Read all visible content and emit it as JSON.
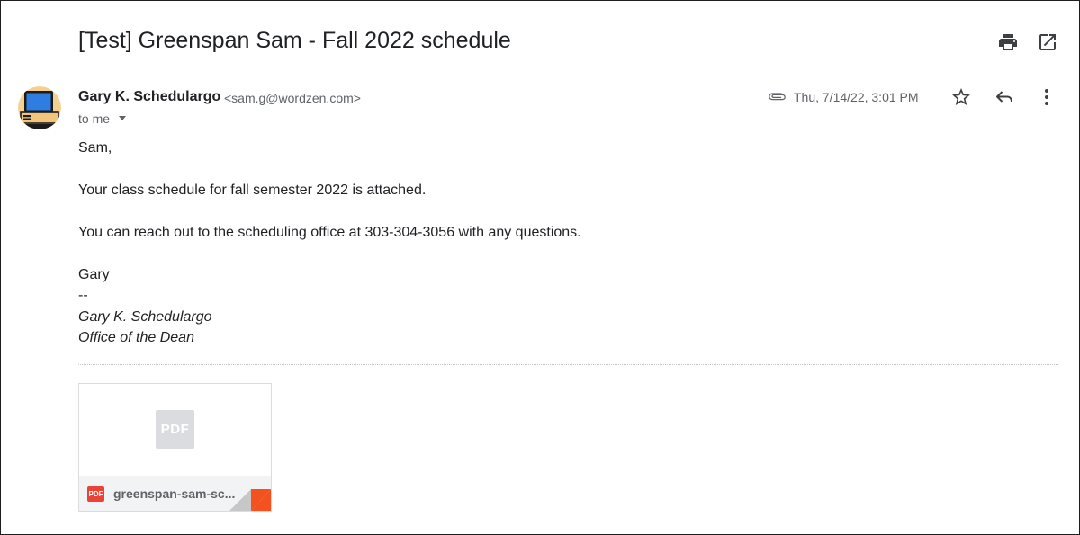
{
  "email": {
    "subject": "[Test] Greenspan Sam - Fall 2022 schedule",
    "sender": {
      "name": "Gary K. Schedulargo",
      "email": "<sam.g@wordzen.com>"
    },
    "recipient_label": "to me",
    "date": "Thu, 7/14/22, 3:01 PM",
    "body": {
      "greeting": "Sam,",
      "line1": "Your class schedule for fall semester 2022 is attached.",
      "line2": "You can reach out to the scheduling office at 303-304-3056 with any questions.",
      "closing": "Gary",
      "sig_sep": "--",
      "sig_name": "Gary K. Schedulargo",
      "sig_title": "Office of the Dean"
    },
    "attachment": {
      "preview_label": "PDF",
      "type_label": "PDF",
      "filename": "greenspan-sam-sc..."
    }
  },
  "icons": {
    "print": "print-icon",
    "new_window": "open-in-new-icon",
    "paperclip": "paperclip-icon",
    "star": "star-icon",
    "reply": "reply-icon",
    "more": "more-vert-icon",
    "caret": "chevron-down-icon"
  },
  "colors": {
    "text_primary": "#202124",
    "text_secondary": "#5f6368",
    "pdf_red": "#ea4335",
    "fold_orange": "#f4511e",
    "avatar_bg": "#f6d08f",
    "avatar_screen": "#2f7de1"
  }
}
